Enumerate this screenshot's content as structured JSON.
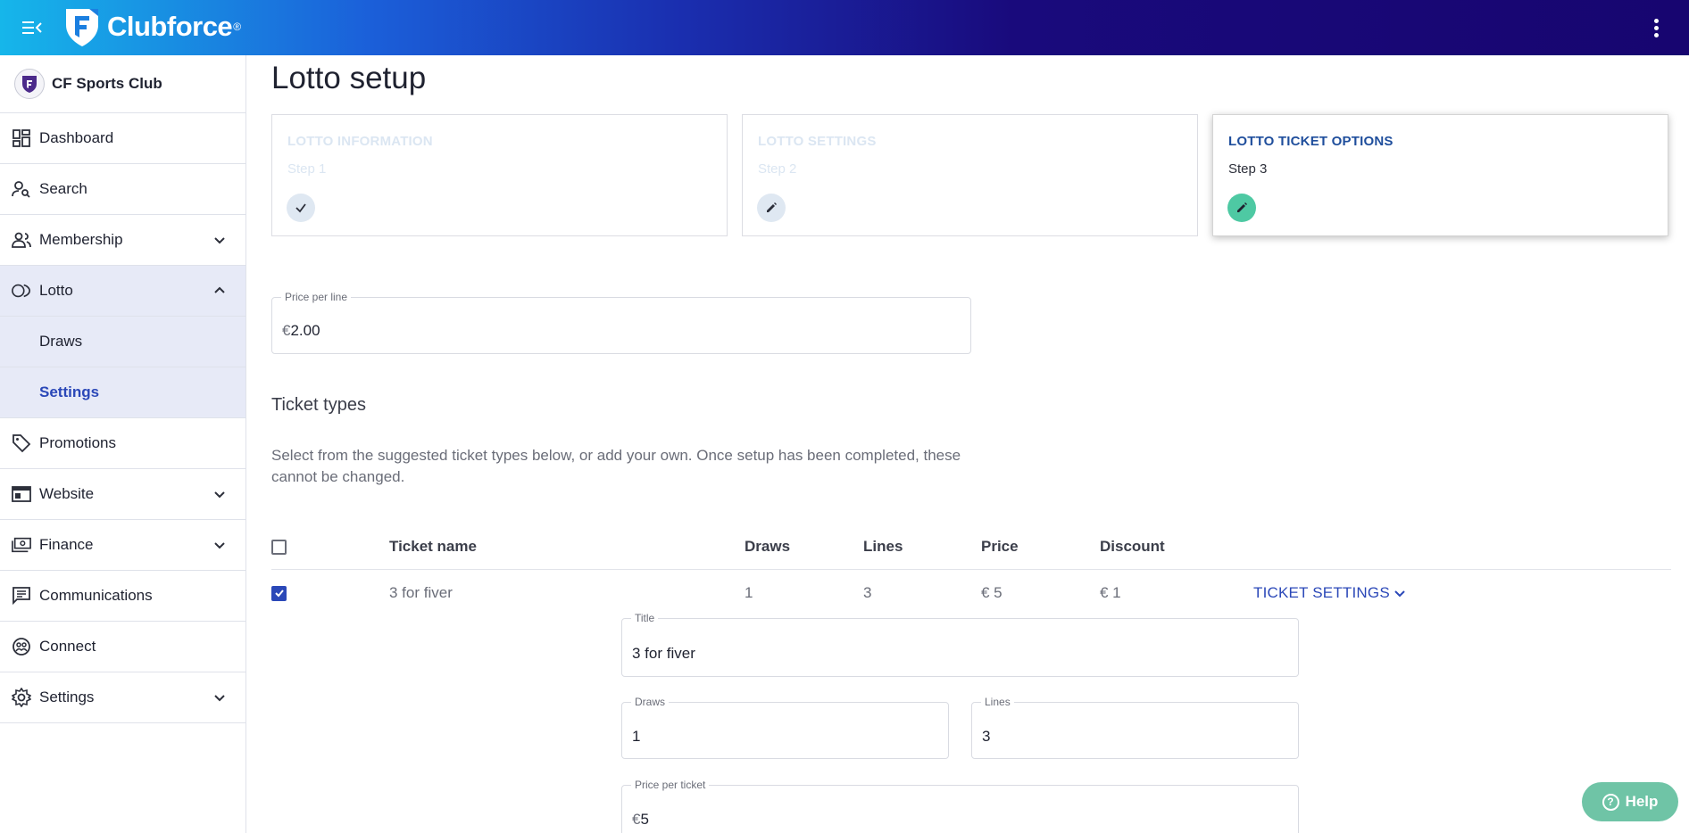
{
  "header": {
    "brand": "Clubforce",
    "brand_mark": "®"
  },
  "sidebar": {
    "club_name": "CF Sports Club",
    "items": [
      {
        "label": "Dashboard"
      },
      {
        "label": "Search"
      },
      {
        "label": "Membership"
      },
      {
        "label": "Lotto"
      },
      {
        "label": "Draws"
      },
      {
        "label": "Settings"
      },
      {
        "label": "Promotions"
      },
      {
        "label": "Website"
      },
      {
        "label": "Finance"
      },
      {
        "label": "Communications"
      },
      {
        "label": "Connect"
      },
      {
        "label": "Settings"
      }
    ]
  },
  "main": {
    "title": "Lotto setup",
    "steps": [
      {
        "title": "LOTTO INFORMATION",
        "sub": "Step 1",
        "state": "done"
      },
      {
        "title": "LOTTO SETTINGS",
        "sub": "Step 2",
        "state": "edit"
      },
      {
        "title": "LOTTO TICKET OPTIONS",
        "sub": "Step 3",
        "state": "current"
      }
    ],
    "price_per_line": {
      "label": "Price per line",
      "prefix": "€",
      "value": "2.00"
    },
    "ticket_types": {
      "title": "Ticket types",
      "description": "Select from the suggested ticket types below, or add your own. Once setup has been completed, these cannot be changed.",
      "columns": [
        "Ticket name",
        "Draws",
        "Lines",
        "Price",
        "Discount"
      ],
      "rows": [
        {
          "name": "3 for fiver",
          "draws": "1",
          "lines": "3",
          "price": "€ 5",
          "discount": "€ 1",
          "settings_label": "TICKET SETTINGS",
          "checked": true
        }
      ],
      "editor": {
        "title_label": "Title",
        "title_value": "3 for fiver",
        "draws_label": "Draws",
        "draws_value": "1",
        "lines_label": "Lines",
        "lines_value": "3",
        "price_label": "Price per ticket",
        "price_prefix": "€",
        "price_value": "5"
      }
    }
  },
  "help": {
    "label": "Help",
    "icon": "?"
  },
  "colors": {
    "accent": "#2b48b8",
    "step_current": "#4ec9a3",
    "help": "#6fc4a6",
    "sidebar_active": "#e7eaf7"
  }
}
